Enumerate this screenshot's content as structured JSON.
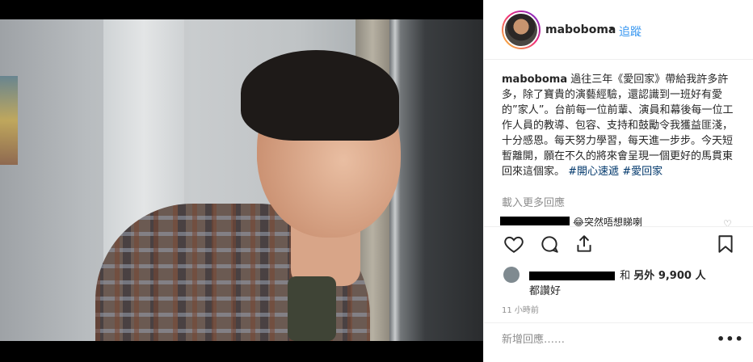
{
  "header": {
    "username": "maboboma",
    "separator": "•",
    "follow_label": "追蹤"
  },
  "caption": {
    "username": "maboboma",
    "text": "過往三年《愛回家》帶給我許多許多，除了寶貴的演藝經驗，還認識到一班好有愛的”家人”。台前每一位前輩、演員和幕後每一位工作人員的教導、包容、支持和鼓勵令我獲益匪淺，十分感恩。每天努力學習，每天進一步步。今天短暫離開，願在不久的將來會呈現一個更好的馬貫東回來這個家。",
    "hashtags": [
      "#開心速遞",
      "#愛回家"
    ]
  },
  "load_more": "載入更多回應",
  "comment": {
    "text": "😂突然唔想睇喇"
  },
  "actions": {
    "like_icon": "heart-icon",
    "comment_icon": "comment-icon",
    "share_icon": "share-icon",
    "save_icon": "bookmark-icon"
  },
  "likes": {
    "prefix": "和",
    "others": "另外 9,900 人",
    "suffix": "都讚好"
  },
  "timestamp": "11 小時前",
  "add_comment": {
    "placeholder": "新增回應……",
    "more_label": "•••"
  },
  "colors": {
    "link": "#3897f0",
    "hashtag": "#00376b",
    "muted": "#8e8e8e"
  }
}
